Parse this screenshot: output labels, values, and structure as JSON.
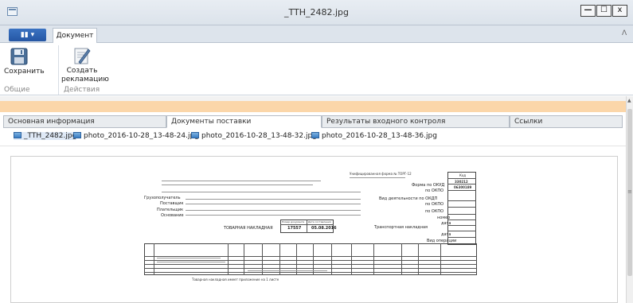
{
  "window": {
    "title": "_TTH_2482.jpg",
    "minimize": "—",
    "maximize": "☐",
    "close": "x"
  },
  "ribbon": {
    "file_button": "▮▮ ▾",
    "tabs": [
      "Документ"
    ],
    "collapse_glyph": "ᐱ",
    "buttons": {
      "save": "Сохранить",
      "claim_line1": "Создать",
      "claim_line2": "рекламацию"
    },
    "groups": {
      "general": "Общие",
      "actions": "Действия"
    }
  },
  "tabs": [
    {
      "label": "Основная информация",
      "active": false
    },
    {
      "label": "Документы поставки",
      "active": true
    },
    {
      "label": "Результаты входного контроля",
      "active": false
    },
    {
      "label": "Ссылки",
      "active": false
    }
  ],
  "files": [
    "_TTH_2482.jpg",
    "photo_2016-10-28_13-48-24.jpg",
    "photo_2016-10-28_13-48-32.jpg",
    "photo_2016-10-28_13-48-36.jpg"
  ],
  "document": {
    "doc_title": "ТОВАРНАЯ НАКЛАДНАЯ",
    "doc_number": "17557",
    "doc_date": "05.08.2016",
    "code_header": "Код",
    "okud_code": "330212",
    "okpo_code": "06300189",
    "form_okud": "Форма по ОКУД",
    "okpo": "по ОКПО",
    "okdp": "Вид деятельности по ОКДП",
    "transport": "Транспортная накладная",
    "operation": "Вид операции",
    "number_header": "Номер документа",
    "date_header": "Дата составления",
    "consignee": "Грузополучатель",
    "supplier": "Поставщик",
    "payer": "Плательщик",
    "basis": "Основание",
    "nomer": "номер",
    "data": "дата",
    "unified_form": "Унифицированная форма № ТОРГ-12",
    "footer": "Товарная накладная имеет приложение на  1  листе"
  }
}
